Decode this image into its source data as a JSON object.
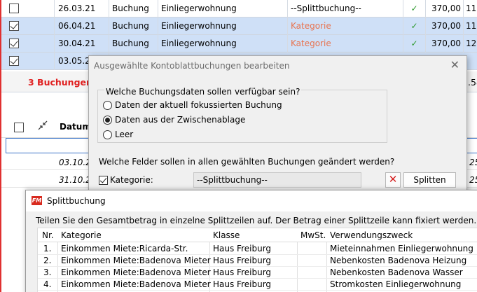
{
  "ledger": {
    "rows": [
      {
        "checked": false,
        "date": "26.03.21",
        "type": "Buchung",
        "payee": "Einliegerwohnung",
        "category": "--Splittbuchung--",
        "category_red": false,
        "amount": "370,00",
        "tail": "11"
      },
      {
        "checked": true,
        "date": "06.04.21",
        "type": "Buchung",
        "payee": "Einliegerwohnung",
        "category": "Kategorie",
        "category_red": true,
        "amount": "370,00",
        "tail": "11"
      },
      {
        "checked": true,
        "date": "30.04.21",
        "type": "Buchung",
        "payee": "Einliegerwohnung",
        "category": "Kategorie",
        "category_red": true,
        "amount": "370,00",
        "tail": "12"
      },
      {
        "checked": true,
        "date": "03.05.2",
        "type": "",
        "payee": "",
        "category": "",
        "category_red": false,
        "amount": "",
        "tail": ""
      }
    ],
    "check_mark": "✓",
    "summary": "3 Buchungen s",
    "summary_right": ".58",
    "col_date": "Datum",
    "data_rows": [
      {
        "date": "03.10.2",
        "right": "25"
      },
      {
        "date": "31.10.2",
        "right": "25"
      }
    ]
  },
  "dialog1": {
    "title": "Ausgewählte Kontoblattbuchungen bearbeiten",
    "close": "✕",
    "question": "Welche Buchungsdaten sollen verfügbar sein?",
    "options": [
      {
        "label": "Daten der aktuell fokussierten Buchung",
        "selected": false
      },
      {
        "label": "Daten aus der Zwischenablage",
        "selected": true
      },
      {
        "label": "Leer",
        "selected": false
      }
    ],
    "fields_question": "Welche Felder sollen in allen gewählten Buchungen geändert werden?",
    "kategorie_label": "Kategorie:",
    "kategorie_value": "--Splittbuchung--",
    "clear_symbol": "✕",
    "split_button": "Splitten"
  },
  "dialog2": {
    "logo": "FM",
    "title": "Splittbuchung",
    "info": "Teilen Sie den Gesamtbetrag in einzelne Splittzeilen auf. Der Betrag einer Splittzeile kann fixiert werden.",
    "columns": {
      "nr": "Nr.",
      "kategorie": "Kategorie",
      "klasse": "Klasse",
      "mwst": "MwSt.",
      "zweck": "Verwendungszweck"
    },
    "rows": [
      {
        "nr": "1.",
        "kategorie": "Einkommen Miete:Ricarda-Str.",
        "klasse": "Haus Freiburg",
        "mwst": "",
        "zweck": "Mieteinnahmen Einliegerwohnung"
      },
      {
        "nr": "2.",
        "kategorie": "Einkommen Miete:Badenova Mieter",
        "klasse": "Haus Freiburg",
        "mwst": "",
        "zweck": "Nebenkosten Badenova Heizung"
      },
      {
        "nr": "3.",
        "kategorie": "Einkommen Miete:Badenova Mieter",
        "klasse": "Haus Freiburg",
        "mwst": "",
        "zweck": "Nebenkosten Badenova Wasser"
      },
      {
        "nr": "4.",
        "kategorie": "Einkommen Miete:Badenova Mieter",
        "klasse": "Haus Freiburg",
        "mwst": "",
        "zweck": "Stromkosten Einliegerwohnung"
      }
    ]
  }
}
